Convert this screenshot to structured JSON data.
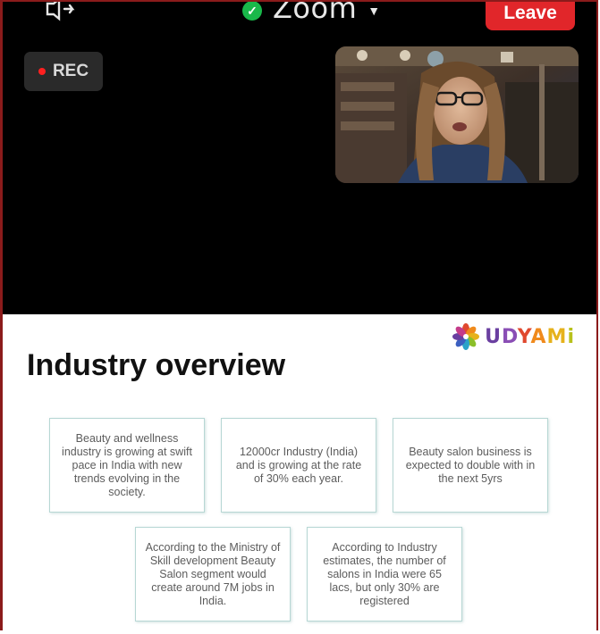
{
  "zoom": {
    "title": "Zoom",
    "leave_label": "Leave",
    "rec_label": "REC"
  },
  "icons": {
    "topbar_left": "audio-switch-icon",
    "security": "shield-check-icon",
    "caret": "chevron-down-icon",
    "brand_logo": "flower-logo-icon"
  },
  "slide": {
    "brand": "UDYAMi",
    "title": "Industry overview",
    "cards": [
      "Beauty and wellness industry is growing at swift pace in India with new trends evolving in the society.",
      "12000cr Industry (India) and is growing at the rate of 30% each year.",
      "Beauty salon business is expected to double with in the  next 5yrs",
      "According to the Ministry of Skill development Beauty Salon segment would create around 7M jobs in India.",
      "According to Industry estimates, the number of salons in India were 65 lacs, but only 30% are registered"
    ]
  },
  "colors": {
    "leave": "#e1262a",
    "rec_dot": "#ff2020",
    "card_border": "#b7d7d4",
    "frame_border": "#8b1b1b"
  }
}
